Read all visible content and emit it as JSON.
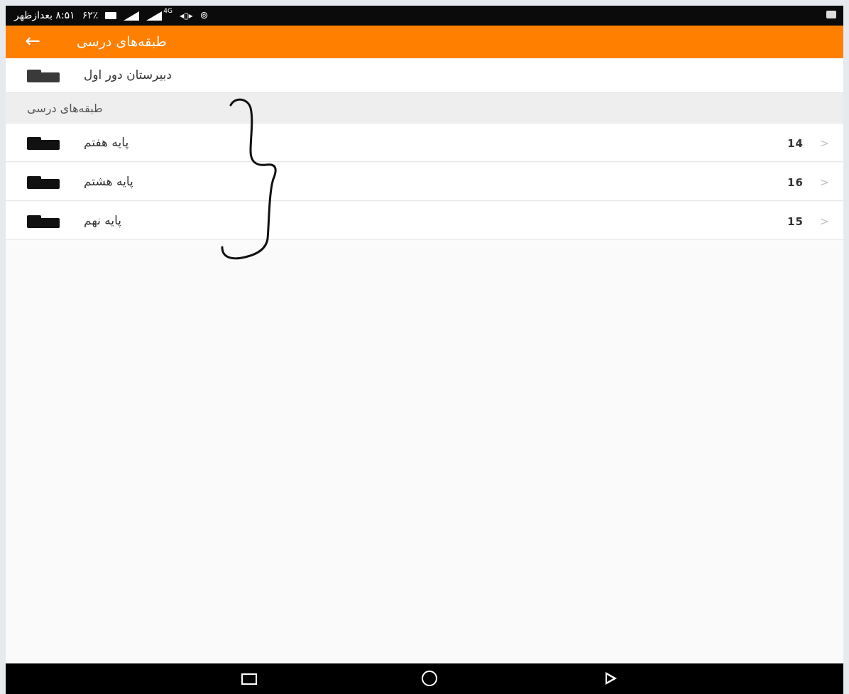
{
  "status_bar": {
    "time_text": "۸:۵۱ بعدازظهر",
    "data_counter": "۶۲٪",
    "network_type": "4G",
    "icons": [
      "battery-icon",
      "signal-icon",
      "signal-icon",
      "vibrate-icon",
      "hotspot-icon",
      "notification-icon"
    ]
  },
  "app_bar": {
    "title": "طبقه‌های درسی",
    "back_icon": "arrow-left-icon",
    "color": "#ff7f00"
  },
  "school_item": {
    "label": "دبیرستان دور اول",
    "icon": "folder-icon"
  },
  "section": {
    "title": "طبقه‌های درسی"
  },
  "grades": [
    {
      "label": "پایه هفتم",
      "count": "14",
      "icon": "folder-icon"
    },
    {
      "label": "پایه هشتم",
      "count": "16",
      "icon": "folder-icon"
    },
    {
      "label": "پایه نهم",
      "count": "15",
      "icon": "folder-icon"
    }
  ],
  "nav_bar": {
    "buttons": [
      "recent-apps-icon",
      "home-icon",
      "back-icon"
    ]
  }
}
